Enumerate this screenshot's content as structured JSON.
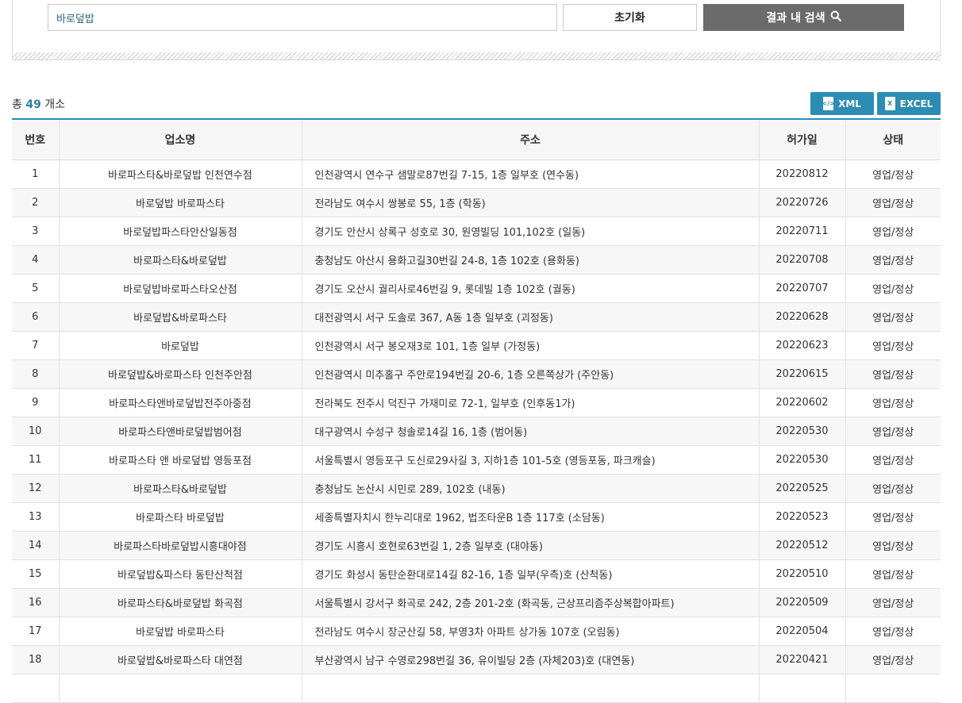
{
  "search": {
    "value": "바로덮밥",
    "reset_label": "초기화",
    "search_label": "결과 내 검색"
  },
  "summary": {
    "prefix": "총",
    "count": "49",
    "suffix": "개소"
  },
  "exports": {
    "xml_label": "XML",
    "excel_label": "EXCEL"
  },
  "table": {
    "headers": [
      "번호",
      "업소명",
      "주소",
      "허가일",
      "상태"
    ],
    "rows": [
      [
        "1",
        "바로파스타&바로덮밥 인천연수점",
        "인천광역시 연수구 샘말로87번길 7-15, 1층 일부호 (연수동)",
        "20220812",
        "영업/정상"
      ],
      [
        "2",
        "바로덮밥 바로파스타",
        "전라남도 여수시 쌍봉로 55, 1층 (학동)",
        "20220726",
        "영업/정상"
      ],
      [
        "3",
        "바로덮밥파스타안산일동점",
        "경기도 안산시 상록구 성호로 30, 원영빌딩 101,102호 (일동)",
        "20220711",
        "영업/정상"
      ],
      [
        "4",
        "바로파스타&바로덮밥",
        "충청남도 아산시 용화고길30번길 24-8, 1층 102호 (용화동)",
        "20220708",
        "영업/정상"
      ],
      [
        "5",
        "바로덮밥바로파스타오산점",
        "경기도 오산시 궐리사로46번길 9, 롯데빌 1층 102호 (궐동)",
        "20220707",
        "영업/정상"
      ],
      [
        "6",
        "바로덮밥&바로파스타",
        "대전광역시 서구 도솔로 367, A동 1층 일부호 (괴정동)",
        "20220628",
        "영업/정상"
      ],
      [
        "7",
        "바로덮밥",
        "인천광역시 서구 봉오재3로 101, 1층 일부 (가정동)",
        "20220623",
        "영업/정상"
      ],
      [
        "8",
        "바로덮밥&바로파스타 인천주안점",
        "인천광역시 미추홀구 주안로194번길 20-6, 1층 오른쪽상가 (주안동)",
        "20220615",
        "영업/정상"
      ],
      [
        "9",
        "바로파스타앤바로덮밥전주아중점",
        "전라북도 전주시 덕진구 가재미로 72-1, 일부호 (인후동1가)",
        "20220602",
        "영업/정상"
      ],
      [
        "10",
        "바로파스타앤바로덮밥범어점",
        "대구광역시 수성구 청솔로14길 16, 1층 (범어동)",
        "20220530",
        "영업/정상"
      ],
      [
        "11",
        "바로파스타 앤 바로덮밥 영등포점",
        "서울특별시 영등포구 도신로29사길 3, 지하1층 101-5호 (영등포동, 파크캐슬)",
        "20220530",
        "영업/정상"
      ],
      [
        "12",
        "바로파스타&바로덮밥",
        "충청남도 논산시 시민로 289, 102호 (내동)",
        "20220525",
        "영업/정상"
      ],
      [
        "13",
        "바로파스타 바로덮밥",
        "세종특별자치시 한누리대로 1962, 법조타운B 1층 117호 (소담동)",
        "20220523",
        "영업/정상"
      ],
      [
        "14",
        "바로파스타바로덮밥시흥대야점",
        "경기도 시흥시 호현로63번길 1, 2층 일부호 (대야동)",
        "20220512",
        "영업/정상"
      ],
      [
        "15",
        "바로덮밥&파스타 동탄산척점",
        "경기도 화성시 동탄순환대로14길 82-16, 1층 일부(우측)호 (산척동)",
        "20220510",
        "영업/정상"
      ],
      [
        "16",
        "바로파스타&바로덮밥 화곡점",
        "서울특별시 강서구 화곡로 242, 2층 201-2호 (화곡동, 근상프리즘주상복합아파트)",
        "20220509",
        "영업/정상"
      ],
      [
        "17",
        "바로덮밥 바로파스타",
        "전라남도 여수시 장군산길 58, 부영3차 아파트 상가동 107호 (오림동)",
        "20220504",
        "영업/정상"
      ],
      [
        "18",
        "바로덮밥&바로파스타 대연점",
        "부산광역시 남구 수영로298번길 36, 유이빌딩 2층 (자체203)호 (대연동)",
        "20220421",
        "영업/정상"
      ],
      [
        "",
        "",
        "",
        "",
        ""
      ]
    ]
  },
  "colors": {
    "accent": "#2d8cb3",
    "count": "#2a7fa6",
    "search_button": "#6b6b6b"
  },
  "icons": {
    "search": "search-icon",
    "xml": "xml-file-icon",
    "excel": "excel-file-icon"
  }
}
